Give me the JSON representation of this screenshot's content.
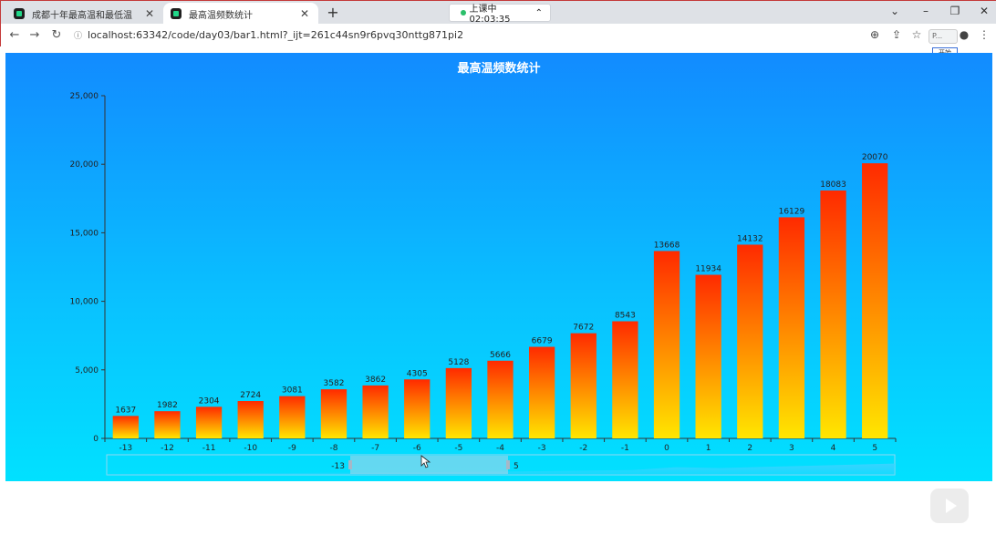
{
  "browser": {
    "tabs": [
      {
        "title": "成都十年最高温和最低温",
        "active": false
      },
      {
        "title": "最高温频数统计",
        "active": true
      }
    ],
    "recording_label": "上课中 02:03:35",
    "url": "localhost:63342/code/day03/bar1.html?_ijt=261c44sn9r6pvq30nttg871pi2",
    "profile_hint": "P...",
    "start_popup": "开始"
  },
  "colors": {
    "bg_top": "#128bff",
    "bg_bottom": "#01e1ff",
    "bar_top": "#ff2a00",
    "bar_bottom": "#ffe600"
  },
  "chart_data": {
    "type": "bar",
    "title": "最高温频数统计",
    "categories": [
      "-13",
      "-12",
      "-11",
      "-10",
      "-9",
      "-8",
      "-7",
      "-6",
      "-5",
      "-4",
      "-3",
      "-2",
      "-1",
      "0",
      "1",
      "2",
      "3",
      "4",
      "5"
    ],
    "values": [
      1637,
      1982,
      2304,
      2724,
      3081,
      3582,
      3862,
      4305,
      5128,
      5666,
      6679,
      7672,
      8543,
      13668,
      11934,
      14132,
      16129,
      18083,
      20070
    ],
    "ylim": [
      0,
      25000
    ],
    "yticks": [
      "0",
      "5,000",
      "10,000",
      "15,000",
      "20,000",
      "25,000"
    ],
    "grid": false,
    "datazoom": {
      "start_label": "-13",
      "end_label": "5"
    }
  }
}
